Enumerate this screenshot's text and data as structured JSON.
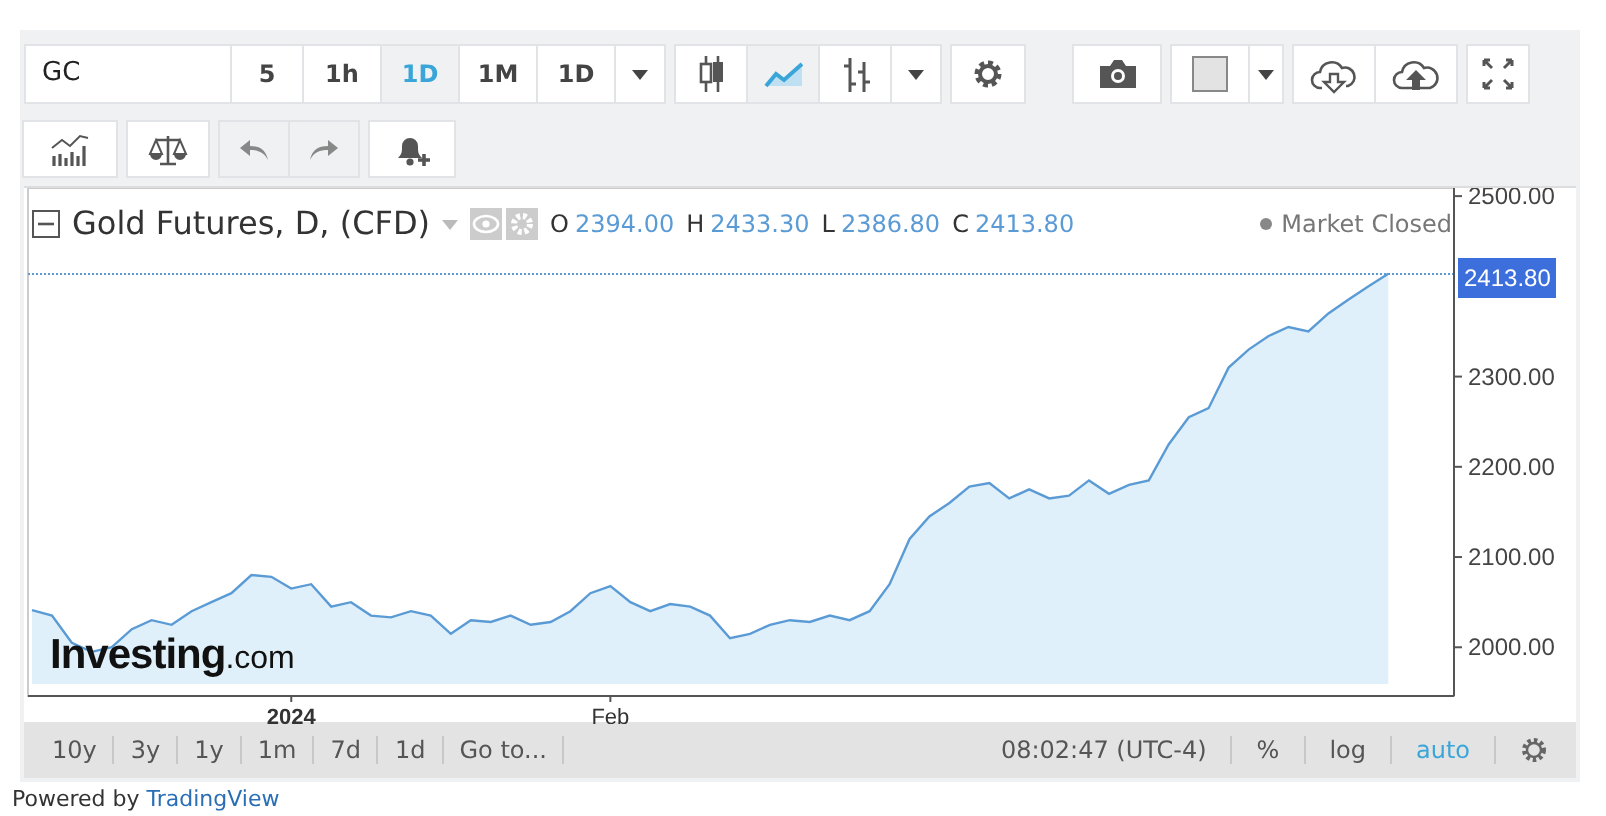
{
  "toolbar": {
    "symbol": {
      "value": "GC"
    },
    "intervals": [
      {
        "label": "5",
        "selected": false
      },
      {
        "label": "1h",
        "selected": false
      },
      {
        "label": "1D",
        "selected": true
      },
      {
        "label": "1M",
        "selected": false
      },
      {
        "label": "1D",
        "selected": false
      }
    ],
    "chart_types": [
      {
        "kind": "candles",
        "selected": false
      },
      {
        "kind": "area",
        "selected": true
      },
      {
        "kind": "bars",
        "selected": false
      }
    ]
  },
  "legend": {
    "title": "Gold Futures, D, (CFD)",
    "ohlc": [
      {
        "key": "O",
        "value": "2394.00"
      },
      {
        "key": "H",
        "value": "2433.30"
      },
      {
        "key": "L",
        "value": "2386.80"
      },
      {
        "key": "C",
        "value": "2413.80"
      }
    ],
    "status": "Market Closed"
  },
  "logo": {
    "main": "Investing",
    "suffix": ".com"
  },
  "chart_data": {
    "type": "area",
    "categories": [
      null,
      null,
      null,
      null,
      null,
      null,
      null,
      null,
      null,
      null,
      null,
      null,
      null,
      "2024",
      null,
      null,
      null,
      null,
      null,
      null,
      null,
      null,
      null,
      null,
      null,
      null,
      null,
      null,
      null,
      "Feb",
      null,
      null,
      null,
      null,
      null,
      null,
      null,
      null,
      null,
      null,
      null,
      null,
      null,
      null,
      null,
      null,
      null,
      null,
      null,
      null,
      null,
      null,
      null,
      null,
      null,
      null,
      null,
      null,
      null,
      null,
      null,
      null,
      null,
      null,
      null,
      null,
      null,
      null,
      null
    ],
    "series": [
      {
        "color": "#5b9bd5",
        "values": [
          2041,
          2035,
          2005,
          1995,
          2000,
          2020,
          2030,
          2025,
          2040,
          2050,
          2060,
          2080,
          2078,
          2065,
          2070,
          2045,
          2050,
          2035,
          2033,
          2040,
          2035,
          2015,
          2030,
          2028,
          2035,
          2025,
          2028,
          2040,
          2060,
          2068,
          2050,
          2040,
          2048,
          2045,
          2035,
          2010,
          2015,
          2025,
          2030,
          2028,
          2035,
          2030,
          2040,
          2070,
          2120,
          2145,
          2160,
          2178,
          2182,
          2165,
          2175,
          2165,
          2168,
          2185,
          2170,
          2180,
          2185,
          2225,
          2255,
          2265,
          2310,
          2330,
          2345,
          2355,
          2350,
          2370,
          2385,
          2400,
          2413.8
        ]
      }
    ],
    "ylim": [
      1946,
      2509
    ],
    "ref_lines": [
      {
        "axis": "y",
        "value": 2413.8,
        "label": "2413.80",
        "color": "#5b9bd5"
      }
    ],
    "yticks": [
      {
        "value": 2000,
        "label": "2000.00"
      },
      {
        "value": 2100,
        "label": "2100.00"
      },
      {
        "value": 2200,
        "label": "2200.00"
      },
      {
        "value": 2300,
        "label": "2300.00"
      },
      {
        "value": 2500,
        "label": "2500.00"
      }
    ]
  },
  "bottom_bar": {
    "ranges": [
      "10y",
      "3y",
      "1y",
      "1m",
      "7d",
      "1d",
      "Go to..."
    ],
    "clock": "08:02:47 (UTC-4)",
    "scale_toggles": [
      {
        "label": "%",
        "selected": false
      },
      {
        "label": "log",
        "selected": false
      },
      {
        "label": "auto",
        "selected": true
      }
    ]
  },
  "footer": {
    "prefix": "Powered by",
    "link": "TradingView"
  }
}
